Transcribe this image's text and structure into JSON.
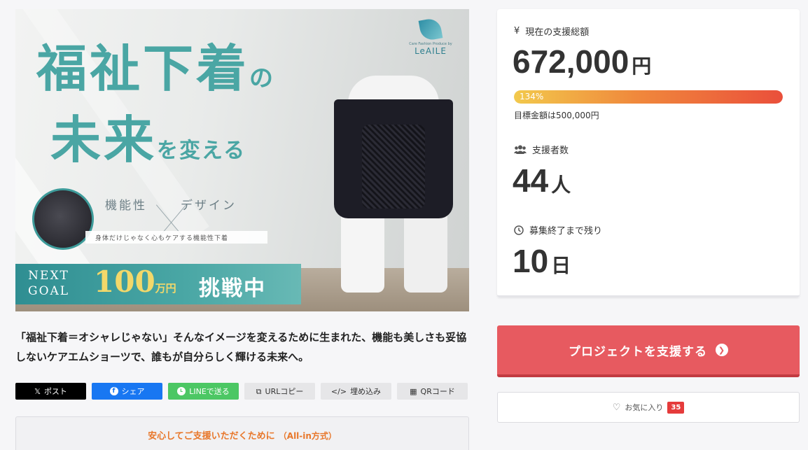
{
  "hero": {
    "title_line1": "福祉下着",
    "title_line1_suffix": "の",
    "title_line2": "未来",
    "title_line2_suffix": "を変える",
    "brand_sub": "Care Fashion Produce by",
    "brand_name": "LeAILE",
    "feature_left": "機能性",
    "feature_right": "デザイン",
    "tagline": "身体だけじゃなく心もケアする機能性下着",
    "next_goal": "NEXT\nGOAL",
    "goal_amount": "100",
    "goal_unit": "万円",
    "challenge": "挑戦中"
  },
  "lead": "「福祉下着＝オシャレじゃない」そんなイメージを変えるために生まれた、機能も美しさも妥協しないケアエムショーツで、誰もが自分らしく輝ける未来へ。",
  "share": {
    "x_label": "ポスト",
    "facebook_label": "シェア",
    "line_label": "LINEで送る",
    "url_label": "URLコピー",
    "embed_label": "埋め込み",
    "qr_label": "QRコード"
  },
  "notice": {
    "text": "安心してご支援いただくために",
    "sub": "（All-in方式）"
  },
  "stats": {
    "total_label": "現在の支援総額",
    "total_amount": "672,000",
    "total_unit": "円",
    "progress_text": "134%",
    "progress_percent": 134,
    "goal_text": "目標金額は500,000円",
    "backers_label": "支援者数",
    "backers_count": "44",
    "backers_unit": "人",
    "remaining_label": "募集終了まで残り",
    "remaining_days": "10",
    "remaining_unit": "日"
  },
  "support_button": "プロジェクトを支援する",
  "favorite": {
    "label": "お気に入り",
    "count": "35"
  },
  "colors": {
    "accent": "#e75a60",
    "teal": "#4aa6a4",
    "progress_start": "#f2c94c",
    "progress_end": "#ea4f3b"
  }
}
